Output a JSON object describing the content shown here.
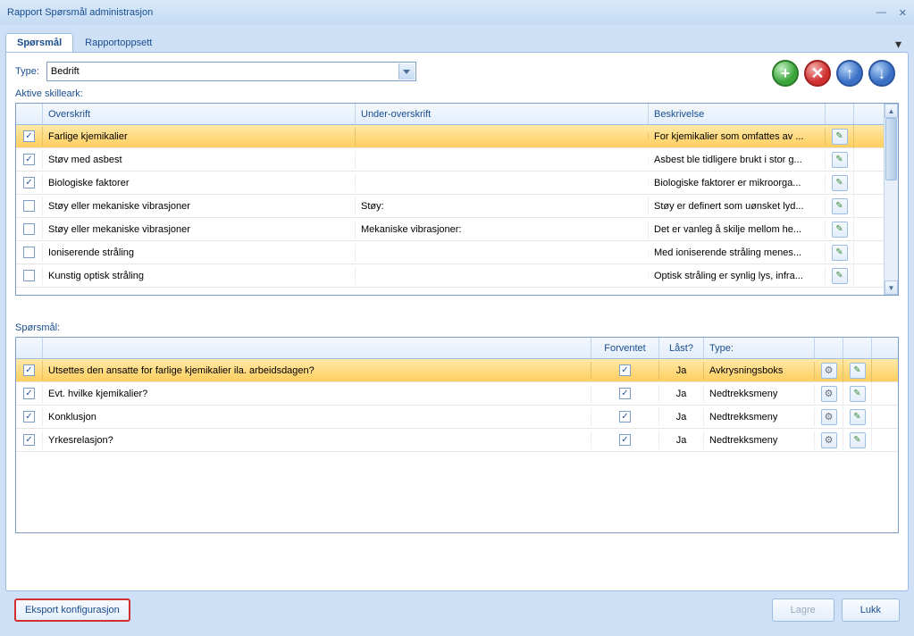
{
  "window": {
    "title": "Rapport Spørsmål administrasjon"
  },
  "tabs": {
    "sporsmal": "Spørsmål",
    "rapportoppsett": "Rapportoppsett"
  },
  "type": {
    "label": "Type:",
    "value": "Bedrift"
  },
  "labels": {
    "aktive_skilleark": "Aktive skilleark:",
    "sporsmal": "Spørsmål:"
  },
  "top_grid": {
    "headers": {
      "overskrift": "Overskrift",
      "under_overskrift": "Under-overskrift",
      "beskrivelse": "Beskrivelse"
    },
    "rows": [
      {
        "checked": true,
        "overskrift": "Farlige kjemikalier",
        "under": "",
        "beskrivelse": "For kjemikalier som omfattes av ...",
        "selected": true
      },
      {
        "checked": true,
        "overskrift": "Støv med asbest",
        "under": "",
        "beskrivelse": "Asbest ble tidligere brukt i stor g..."
      },
      {
        "checked": true,
        "overskrift": "Biologiske faktorer",
        "under": "",
        "beskrivelse": "Biologiske faktorer er mikroorga..."
      },
      {
        "checked": false,
        "overskrift": "Støy eller mekaniske vibrasjoner",
        "under": "Støy:",
        "beskrivelse": "Støy er definert som uønsket lyd..."
      },
      {
        "checked": false,
        "overskrift": "Støy eller mekaniske vibrasjoner",
        "under": "Mekaniske vibrasjoner:",
        "beskrivelse": "Det er vanleg å skilje mellom he..."
      },
      {
        "checked": false,
        "overskrift": "Ioniserende stråling",
        "under": "",
        "beskrivelse": "Med ioniserende stråling menes..."
      },
      {
        "checked": false,
        "overskrift": "Kunstig optisk stråling",
        "under": "",
        "beskrivelse": "Optisk stråling er synlig lys, infra..."
      }
    ]
  },
  "bottom_grid": {
    "headers": {
      "blank": "",
      "forventet": "Forventet",
      "last": "Låst?",
      "type": "Type:"
    },
    "rows": [
      {
        "checked": true,
        "text": "Utsettes den ansatte for farlige kjemikalier ila. arbeidsdagen?",
        "forventet": true,
        "last": "Ja",
        "type": "Avkrysningsboks",
        "selected": true
      },
      {
        "checked": true,
        "text": "Evt. hvilke kjemikalier?",
        "forventet": true,
        "last": "Ja",
        "type": "Nedtrekksmeny"
      },
      {
        "checked": true,
        "text": "Konklusjon",
        "forventet": true,
        "last": "Ja",
        "type": "Nedtrekksmeny"
      },
      {
        "checked": true,
        "text": "Yrkesrelasjon?",
        "forventet": true,
        "last": "Ja",
        "type": "Nedtrekksmeny"
      }
    ]
  },
  "footer": {
    "eksport": "Eksport konfigurasjon",
    "lagre": "Lagre",
    "lukk": "Lukk"
  }
}
